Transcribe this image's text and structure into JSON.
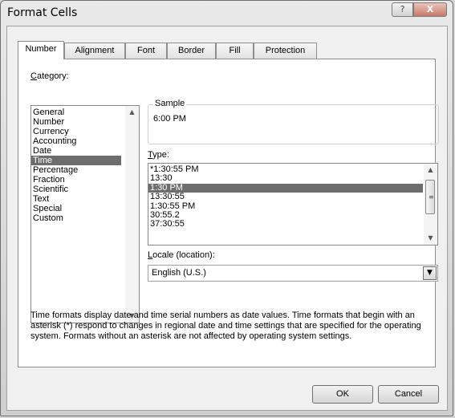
{
  "window": {
    "title": "Format Cells",
    "help_glyph": "?",
    "close_glyph": "X"
  },
  "tabs": [
    "Number",
    "Alignment",
    "Font",
    "Border",
    "Fill",
    "Protection"
  ],
  "active_tab": "Number",
  "category": {
    "label_accel": "C",
    "label_rest": "ategory:",
    "items": [
      "General",
      "Number",
      "Currency",
      "Accounting",
      "Date",
      "Time",
      "Percentage",
      "Fraction",
      "Scientific",
      "Text",
      "Special",
      "Custom"
    ],
    "selected": "Time"
  },
  "sample": {
    "label": "Sample",
    "value": "6:00 PM"
  },
  "type": {
    "label_accel": "T",
    "label_rest": "ype:",
    "items": [
      "*1:30:55 PM",
      "13:30",
      "1:30 PM",
      "13:30:55",
      "1:30:55 PM",
      "30:55.2",
      "37:30:55"
    ],
    "selected": "1:30 PM"
  },
  "locale": {
    "label_accel": "L",
    "label_rest": "ocale (location):",
    "value": "English (U.S.)"
  },
  "description": "Time formats display date and time serial numbers as date values.  Time formats that begin with an asterisk (*) respond to changes in regional date and time settings that are specified for the operating system. Formats without an asterisk are not affected by operating system settings.",
  "buttons": {
    "ok": "OK",
    "cancel": "Cancel"
  },
  "icons": {
    "up": "scroll-up-icon",
    "down": "scroll-down-icon",
    "dropdown": "chevron-down-icon"
  }
}
